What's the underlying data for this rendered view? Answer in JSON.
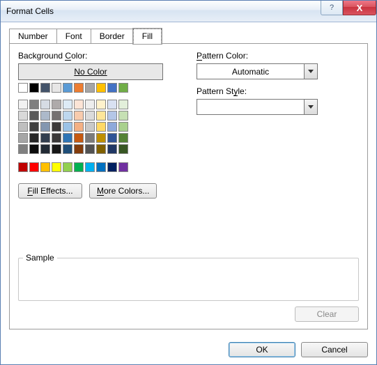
{
  "window": {
    "title": "Format Cells"
  },
  "titlebar_buttons": {
    "help": "?",
    "close": "X"
  },
  "tabs": [
    "Number",
    "Font",
    "Border",
    "Fill"
  ],
  "active_tab_index": 3,
  "fill": {
    "bg_label": "Background Color:",
    "no_color": "No Color",
    "fill_effects": "Fill Effects...",
    "more_colors": "More Colors...",
    "pattern_color_label": "Pattern Color:",
    "pattern_color_value": "Automatic",
    "pattern_style_label": "Pattern Style:",
    "pattern_style_value": "",
    "sample_label": "Sample",
    "clear": "Clear"
  },
  "buttons": {
    "ok": "OK",
    "cancel": "Cancel"
  },
  "palette": {
    "theme_row": [
      "#FFFFFF",
      "#000000",
      "#44546A",
      "#E7E6E6",
      "#5B9BD5",
      "#ED7D31",
      "#A5A5A5",
      "#FFC000",
      "#4472C4",
      "#70AD47"
    ],
    "tints": [
      [
        "#F2F2F2",
        "#7F7F7F",
        "#D6DCE4",
        "#AEAAAA",
        "#DDEBF6",
        "#FCE4D6",
        "#EDEDED",
        "#FFF2CC",
        "#D9E1F2",
        "#E2EFDA"
      ],
      [
        "#D9D9D9",
        "#595959",
        "#ACB9CA",
        "#757171",
        "#BDD7EE",
        "#F8CBAD",
        "#DBDBDB",
        "#FFE699",
        "#B4C6E7",
        "#C6E0B4"
      ],
      [
        "#BFBFBF",
        "#404040",
        "#8497B0",
        "#3A3838",
        "#9BC2E6",
        "#F4B084",
        "#C9C9C9",
        "#FFD966",
        "#8EA9DB",
        "#A9D08E"
      ],
      [
        "#A6A6A6",
        "#262626",
        "#333F4F",
        "#3A3838",
        "#2F75B5",
        "#C65911",
        "#7B7B7B",
        "#BF8F00",
        "#305496",
        "#548235"
      ],
      [
        "#808080",
        "#0D0D0D",
        "#222B35",
        "#171717",
        "#1F4E78",
        "#833C0C",
        "#525252",
        "#806000",
        "#203764",
        "#375623"
      ]
    ],
    "standard": [
      "#C00000",
      "#FF0000",
      "#FFC000",
      "#FFFF00",
      "#92D050",
      "#00B050",
      "#00B0F0",
      "#0070C0",
      "#002060",
      "#7030A0"
    ]
  }
}
